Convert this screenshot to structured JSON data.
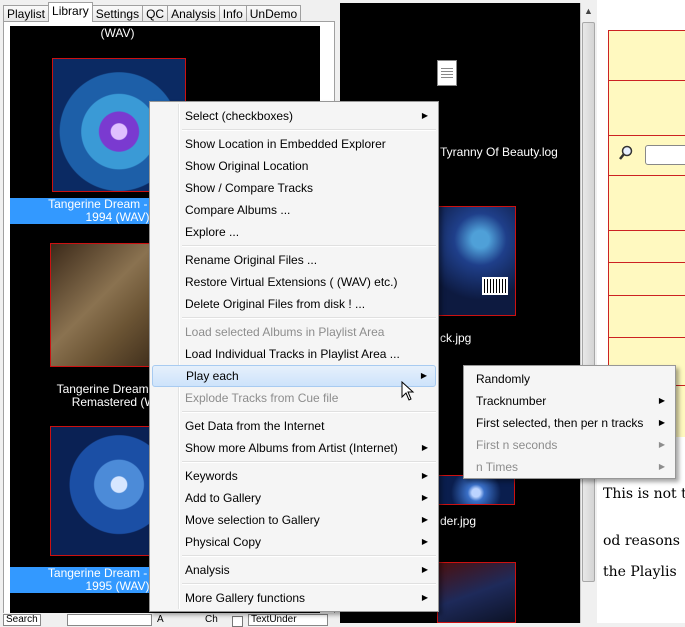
{
  "tabs": [
    {
      "label": "Playlist"
    },
    {
      "label": "Library"
    },
    {
      "label": "Settings"
    },
    {
      "label": "QC"
    },
    {
      "label": "Analysis"
    },
    {
      "label": "Info"
    },
    {
      "label": "UnDemo"
    }
  ],
  "library": {
    "top_label": "(WAV)",
    "albums": [
      {
        "caption_line1": "Tangerine Dream - Turn C",
        "caption_line2": "1994 (WAV)"
      },
      {
        "caption_line1": "Tangerine Dream - Tyg",
        "caption_line2": "Remastered (WA"
      },
      {
        "caption_line1": "Tangerine Dream - Tyrann",
        "caption_line2": "1995 (WAV)"
      }
    ]
  },
  "bottom_bar": {
    "search_label": "Search",
    "a_label": "A",
    "check_label": "Ch",
    "text_under_label": "TextUnder"
  },
  "explorer": {
    "files": [
      {
        "label": "Tyranny Of Beauty.log"
      },
      {
        "label": "ck.jpg"
      },
      {
        "label": "der.jpg"
      }
    ]
  },
  "right_panel": {
    "lines": [
      {
        "text": "This is not t"
      },
      {
        "text": "od reasons"
      },
      {
        "text": "the Playlis"
      }
    ]
  },
  "context_menu": {
    "items": [
      {
        "label": "Select (checkboxes)",
        "submenu": true,
        "disabled": false
      },
      {
        "label": "Show Location in Embedded Explorer",
        "submenu": false,
        "disabled": false
      },
      {
        "label": "Show Original Location",
        "submenu": false,
        "disabled": false
      },
      {
        "label": "Show / Compare Tracks",
        "submenu": false,
        "disabled": false
      },
      {
        "label": "Compare Albums ...",
        "submenu": false,
        "disabled": false
      },
      {
        "label": "Explore ...",
        "submenu": false,
        "disabled": false
      },
      {
        "label": "Rename Original Files ...",
        "submenu": false,
        "disabled": false
      },
      {
        "label": "Restore Virtual Extensions ( (WAV) etc.)",
        "submenu": false,
        "disabled": false
      },
      {
        "label": "Delete Original Files from disk ! ...",
        "submenu": false,
        "disabled": false
      },
      {
        "label": "Load selected Albums in Playlist Area",
        "submenu": false,
        "disabled": true
      },
      {
        "label": "Load Individual Tracks in Playlist Area ...",
        "submenu": false,
        "disabled": false
      },
      {
        "label": "Play each",
        "submenu": true,
        "disabled": false,
        "highlighted": true
      },
      {
        "label": "Explode Tracks from Cue file",
        "submenu": false,
        "disabled": true
      },
      {
        "label": "Get Data from the Internet",
        "submenu": false,
        "disabled": false
      },
      {
        "label": "Show more Albums from Artist (Internet)",
        "submenu": true,
        "disabled": false
      },
      {
        "label": "Keywords",
        "submenu": true,
        "disabled": false
      },
      {
        "label": "Add to Gallery",
        "submenu": true,
        "disabled": false
      },
      {
        "label": "Move selection to Gallery",
        "submenu": true,
        "disabled": false
      },
      {
        "label": "Physical Copy",
        "submenu": true,
        "disabled": false
      },
      {
        "label": "Analysis",
        "submenu": true,
        "disabled": false
      },
      {
        "label": "More Gallery functions",
        "submenu": true,
        "disabled": false
      }
    ],
    "arrow_glyph": "▶"
  },
  "play_each_submenu": {
    "items": [
      {
        "label": "Randomly",
        "submenu": false,
        "disabled": false
      },
      {
        "label": "Tracknumber",
        "submenu": true,
        "disabled": false
      },
      {
        "label": "First selected, then per n tracks",
        "submenu": true,
        "disabled": false
      },
      {
        "label": "First n seconds",
        "submenu": true,
        "disabled": true
      },
      {
        "label": "n Times",
        "submenu": true,
        "disabled": true
      }
    ]
  },
  "colors": {
    "selection": "#3399ff",
    "menu_highlight": "#cde3fb",
    "panel_yellow": "#fff9c0",
    "cover_border": "#cc1111"
  }
}
